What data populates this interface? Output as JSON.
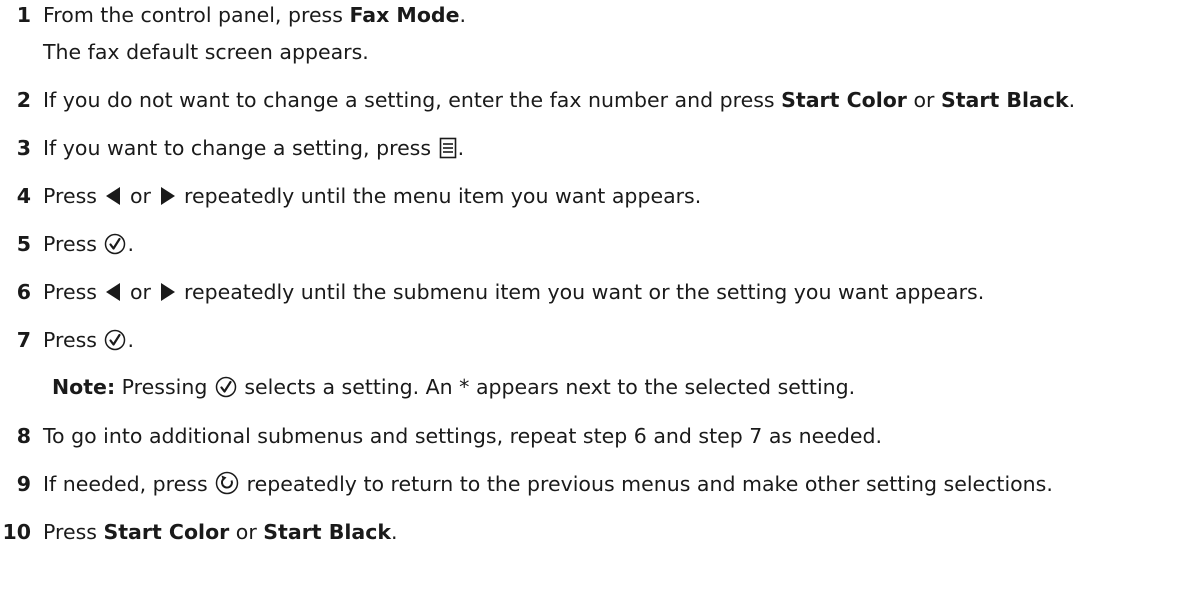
{
  "steps": [
    {
      "num": "1",
      "parts": [
        "From the control panel, press ",
        "Fax Mode",
        "."
      ],
      "sub": "The fax default screen appears."
    },
    {
      "num": "2",
      "parts": [
        "If you do not want to change a setting, enter the fax number and press ",
        "Start Color",
        " or ",
        "Start Black",
        "."
      ]
    },
    {
      "num": "3",
      "parts": [
        "If you want to change a setting, press ",
        "."
      ],
      "icon": "menu-icon"
    },
    {
      "num": "4",
      "parts": [
        "Press ",
        " or ",
        " repeatedly until the menu item you want appears."
      ],
      "icons": [
        "left-arrow-icon",
        "right-arrow-icon"
      ]
    },
    {
      "num": "5",
      "parts": [
        "Press ",
        "."
      ],
      "icon": "select-icon"
    },
    {
      "num": "6",
      "parts": [
        "Press ",
        " or ",
        " repeatedly until the submenu item you want or the setting you want appears."
      ],
      "icons": [
        "left-arrow-icon",
        "right-arrow-icon"
      ]
    },
    {
      "num": "7",
      "parts": [
        "Press ",
        "."
      ],
      "icon": "select-icon"
    },
    {
      "num": "8",
      "parts": [
        "To go into additional submenus and settings, repeat step 6 and step 7 as needed."
      ]
    },
    {
      "num": "9",
      "parts": [
        "If needed, press ",
        " repeatedly to return to the previous menus and make other setting selections."
      ],
      "icon": "back-icon"
    },
    {
      "num": "10",
      "parts": [
        "Press ",
        "Start Color",
        " or ",
        "Start Black",
        "."
      ]
    }
  ],
  "note": {
    "label": "Note:",
    "parts": [
      " Pressing ",
      " selects a setting. An * appears next to the selected setting."
    ],
    "icon": "select-icon"
  }
}
